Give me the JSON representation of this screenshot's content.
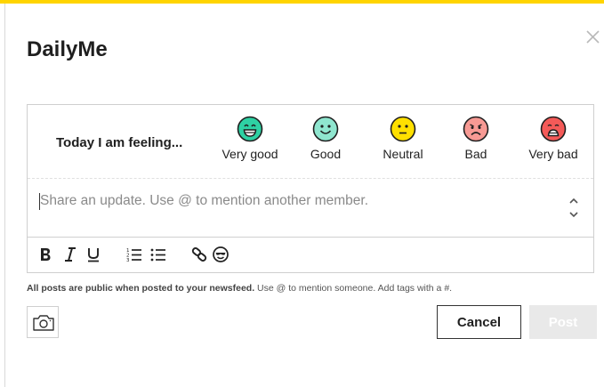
{
  "dialog": {
    "title": "DailyMe",
    "accent_color": "#ffd400"
  },
  "mood": {
    "prompt": "Today I am feeling...",
    "options": [
      {
        "label": "Very good",
        "icon": "grinning-face-icon",
        "color": "#2ed1a3"
      },
      {
        "label": "Good",
        "icon": "smiling-face-icon",
        "color": "#8fe6cf"
      },
      {
        "label": "Neutral",
        "icon": "neutral-face-icon",
        "color": "#ffe000"
      },
      {
        "label": "Bad",
        "icon": "frowning-face-icon",
        "color": "#f79a94"
      },
      {
        "label": "Very bad",
        "icon": "crying-face-icon",
        "color": "#f45a58"
      }
    ]
  },
  "update": {
    "placeholder": "Share an update. Use @ to mention another member.",
    "value": ""
  },
  "toolbar": {
    "items": [
      "bold-icon",
      "italic-icon",
      "underline-icon",
      "numbered-list-icon",
      "bulleted-list-icon",
      "link-icon",
      "emoji-icon"
    ]
  },
  "notice": {
    "bold_text": "All posts are public when posted to your newsfeed.",
    "text": " Use @ to mention someone. Add tags with a #."
  },
  "actions": {
    "cancel_label": "Cancel",
    "post_label": "Post",
    "post_disabled": true
  }
}
